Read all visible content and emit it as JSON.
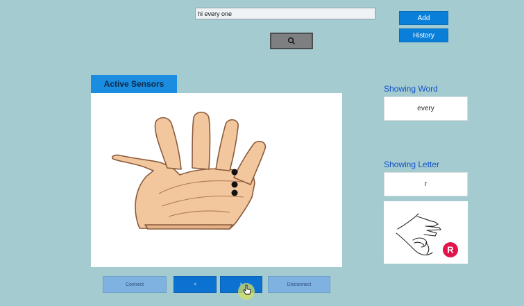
{
  "toolbar": {
    "input_value": "hi every one",
    "add_label": "Add",
    "history_label": "History",
    "search_icon": "search-icon"
  },
  "sensors": {
    "tab_label": "Active Sensors",
    "active_dots": 3
  },
  "word": {
    "label": "Showing Word",
    "value": "every"
  },
  "letter": {
    "label": "Showing Letter",
    "value": "r",
    "badge": "R"
  },
  "bottom_buttons": {
    "connect": "Connect",
    "prev": "<",
    "next": ">",
    "disconnect": "Disconnect"
  },
  "colors": {
    "background": "#a3cbd0",
    "accent": "#0a7fd9",
    "badge": "#e3134c"
  }
}
